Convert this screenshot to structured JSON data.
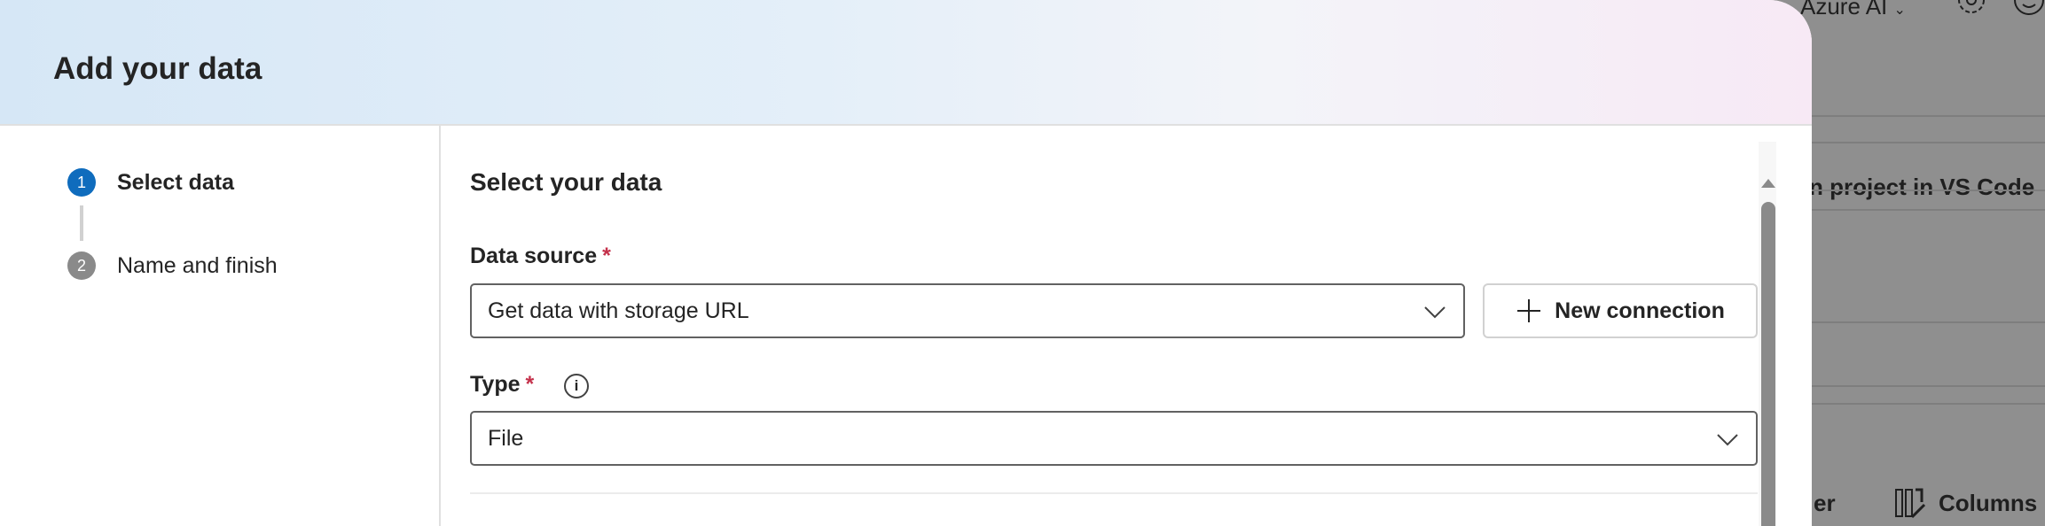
{
  "background": {
    "account_label": "Azure AI",
    "row_text": "n project in VS Code",
    "filter_partial": "er",
    "columns_label": "Columns"
  },
  "modal": {
    "title": "Add your data",
    "steps": [
      {
        "number": "1",
        "label": "Select data",
        "state": "active"
      },
      {
        "number": "2",
        "label": "Name and finish",
        "state": "pending"
      }
    ],
    "section_title": "Select your data",
    "data_source": {
      "label": "Data source",
      "required_mark": "*",
      "value": "Get data with storage URL"
    },
    "new_connection_label": "New connection",
    "type": {
      "label": "Type",
      "required_mark": "*",
      "info": "i",
      "value": "File"
    }
  },
  "colors": {
    "accent": "#0f6cbd",
    "required": "#c4314b",
    "overlay": "#8f8f8f"
  }
}
